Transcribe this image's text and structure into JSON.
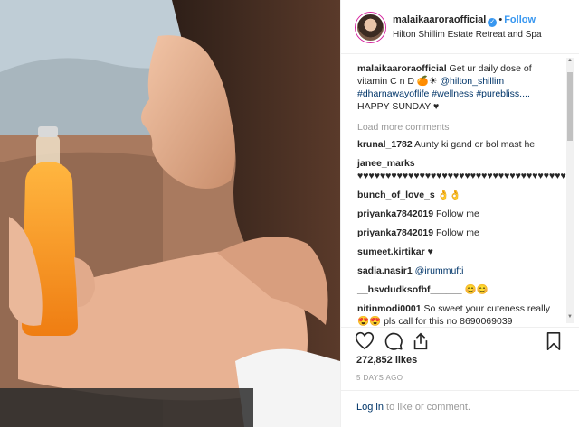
{
  "header": {
    "username": "malaikaaroraofficial",
    "verified_mark": "✓",
    "separator": "•",
    "follow_label": "Follow",
    "location": "Hilton Shillim Estate Retreat and Spa"
  },
  "caption": {
    "username": "malaikaaroraofficial",
    "text": " Get ur daily dose of vitamin C n D 🍊☀ ",
    "mention": "@hilton_shillim",
    "hashtags": " #dharnawayoflife #wellness #purebliss....",
    "line2": "HAPPY SUNDAY ♥"
  },
  "load_more_label": "Load more comments",
  "comments": [
    {
      "user": "krunal_1782",
      "text": " Aunty ki gand or bol mast he"
    },
    {
      "user": "janee_marks",
      "text": " ♥♥♥♥♥♥♥♥♥♥♥♥♥♥♥♥♥♥♥♥♥♥♥♥♥♥♥♥♥♥♥♥♥♥♥♥♥♥♥♥♥♥♥♥♥♥♥"
    },
    {
      "user": "bunch_of_love_s",
      "text": " 👌👌"
    },
    {
      "user": "priyanka7842019",
      "text": " Follow me"
    },
    {
      "user": "priyanka7842019",
      "text": " Follow me"
    },
    {
      "user": "sumeet.kirtikar",
      "text": " ♥"
    },
    {
      "user": "sadia.nasir1",
      "text": " ",
      "mention": "@irummufti"
    },
    {
      "user": "__hsvdudksofbf______",
      "text": " 😊😊"
    },
    {
      "user": "nitinmodi0001",
      "text": " So sweet your cuteness really 😍😍 pls call for this no 8690069039"
    }
  ],
  "icons": {
    "like": "heart-icon",
    "comment": "comment-bubble-icon",
    "share": "share-icon",
    "save": "bookmark-icon"
  },
  "likes_label": "272,852 likes",
  "timestamp": "5 DAYS AGO",
  "login": {
    "link": "Log in",
    "text": " to like or comment."
  },
  "colors": {
    "link_blue": "#3897f0",
    "hashtag": "#003569",
    "muted": "#999999"
  }
}
